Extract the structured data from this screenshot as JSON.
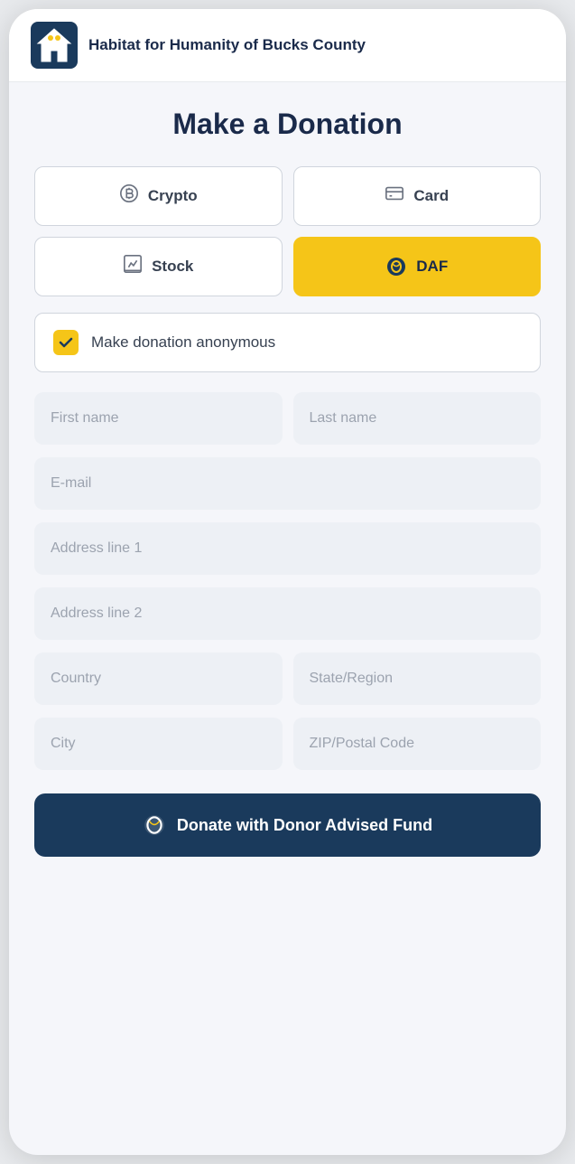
{
  "header": {
    "title": "Habitat for Humanity of Bucks County",
    "logo_alt": "Habitat for Humanity Logo"
  },
  "page": {
    "title": "Make a Donation"
  },
  "payment_types": [
    {
      "id": "crypto",
      "label": "Crypto",
      "icon": "bitcoin",
      "active": false
    },
    {
      "id": "card",
      "label": "Card",
      "icon": "card",
      "active": false
    },
    {
      "id": "stock",
      "label": "Stock",
      "icon": "stock",
      "active": false
    },
    {
      "id": "daf",
      "label": "DAF",
      "icon": "daf",
      "active": true
    }
  ],
  "anonymous": {
    "label": "Make donation anonymous",
    "checked": true
  },
  "form": {
    "first_name_placeholder": "First name",
    "last_name_placeholder": "Last name",
    "email_placeholder": "E-mail",
    "address1_placeholder": "Address line 1",
    "address2_placeholder": "Address line 2",
    "country_placeholder": "Country",
    "state_placeholder": "State/Region",
    "city_placeholder": "City",
    "zip_placeholder": "ZIP/Postal Code"
  },
  "submit": {
    "label": "Donate with Donor Advised Fund"
  }
}
